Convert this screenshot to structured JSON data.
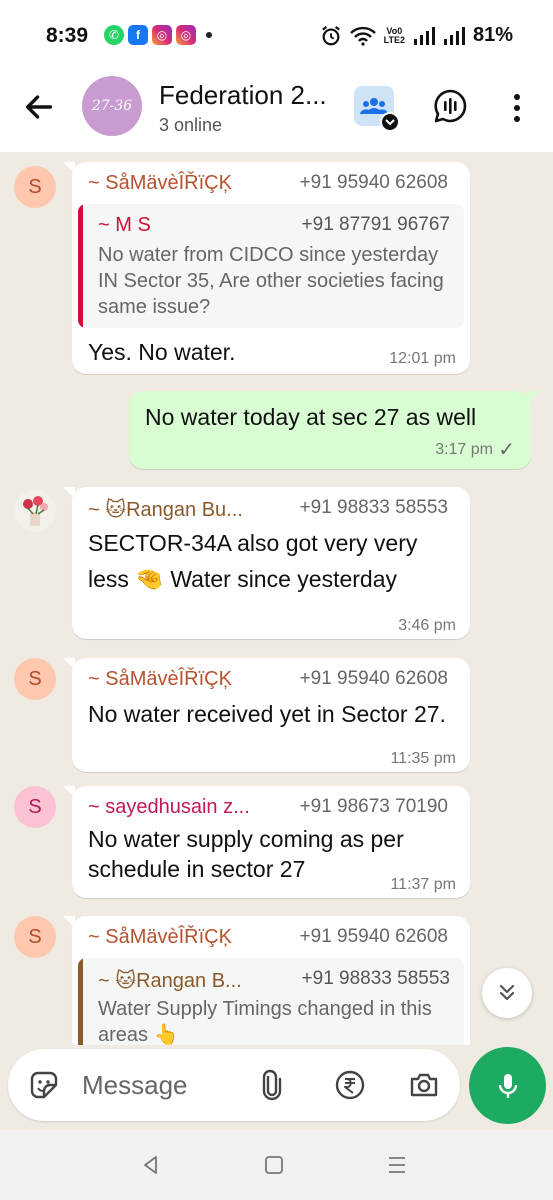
{
  "status_bar": {
    "time": "8:39",
    "notification_apps": [
      "whatsapp-icon",
      "facebook-icon",
      "instagram-icon",
      "instagram-icon"
    ],
    "network_label_top": "Vo0",
    "network_label_bottom": "LTE2",
    "battery": "81%"
  },
  "header": {
    "avatar_text": "27-36",
    "title": "Federation 2...",
    "subtitle": "3 online"
  },
  "messages": [
    {
      "sender": "~ SåMävèÎŘïÇĶ",
      "sender_color": "#b5532f",
      "phone": "+91 95940 62608",
      "avatar_letter": "S",
      "quote": {
        "sender": "~ M S",
        "phone": "+91 87791 96767",
        "text": "No water from CIDCO since yesterday IN Sector 35, Are other societies facing same issue?",
        "bar_color": "#d0103a"
      },
      "text": "Yes. No water.",
      "time": "12:01 pm"
    },
    {
      "outgoing": true,
      "text": "No water today at sec 27 as well",
      "time": "3:17 pm",
      "status": "✓"
    },
    {
      "sender": "~ 🐱Rangan Bu...",
      "sender_color": "#8a5a2b",
      "phone": "+91 98833 58553",
      "text": "SECTOR-34A also got very very less 🤏 Water since yesterday",
      "time": "3:46 pm"
    },
    {
      "sender": "~ SåMävèÎŘïÇĶ",
      "sender_color": "#b5532f",
      "phone": "+91 95940 62608",
      "avatar_letter": "S",
      "text": "No water received yet in Sector 27.",
      "time": "11:35 pm"
    },
    {
      "sender": "~ sayedhusain z...",
      "sender_color": "#c2185b",
      "phone": "+91 98673 70190",
      "avatar_letter": "S",
      "text": "No water supply coming as per schedule in sector 27",
      "time": "11:37 pm"
    },
    {
      "sender": "~ SåMävèÎŘïÇĶ",
      "sender_color": "#b5532f",
      "phone": "+91 95940 62608",
      "avatar_letter": "S",
      "quote": {
        "sender": "~ 🐱Rangan B...",
        "phone": "+91 98833 58553",
        "text": "Water Supply Timings changed in this areas 👆",
        "bar_color": "#8a5a2b"
      }
    }
  ],
  "composer": {
    "placeholder": "Message",
    "icons": [
      "sticker-icon",
      "attach-icon",
      "rupee-icon",
      "camera-icon",
      "mic-icon"
    ]
  },
  "colors": {
    "chat_background": "#efeae2",
    "outgoing_bubble": "#d9fdd3",
    "accent_green": "#1daa61"
  }
}
